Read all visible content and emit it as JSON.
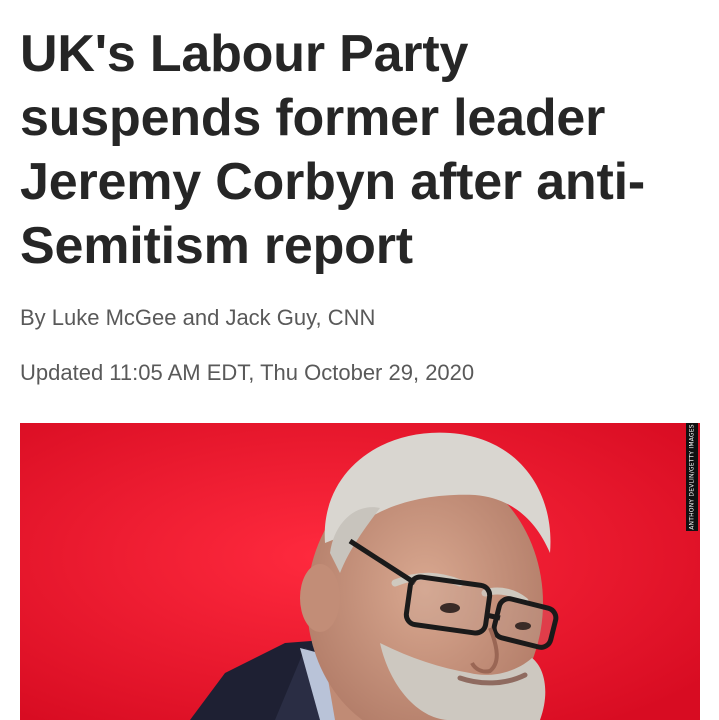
{
  "article": {
    "headline": "UK's Labour Party suspends former leader Jeremy Corbyn after anti-Semitism report",
    "byline": "By Luke McGee and Jack Guy, CNN",
    "updated": "Updated 11:05 AM EDT, Thu October 29, 2020"
  },
  "photo": {
    "credit": "ANTHONY DEVLIN/GETTY IMAGES",
    "background_color": "#e8102a"
  }
}
